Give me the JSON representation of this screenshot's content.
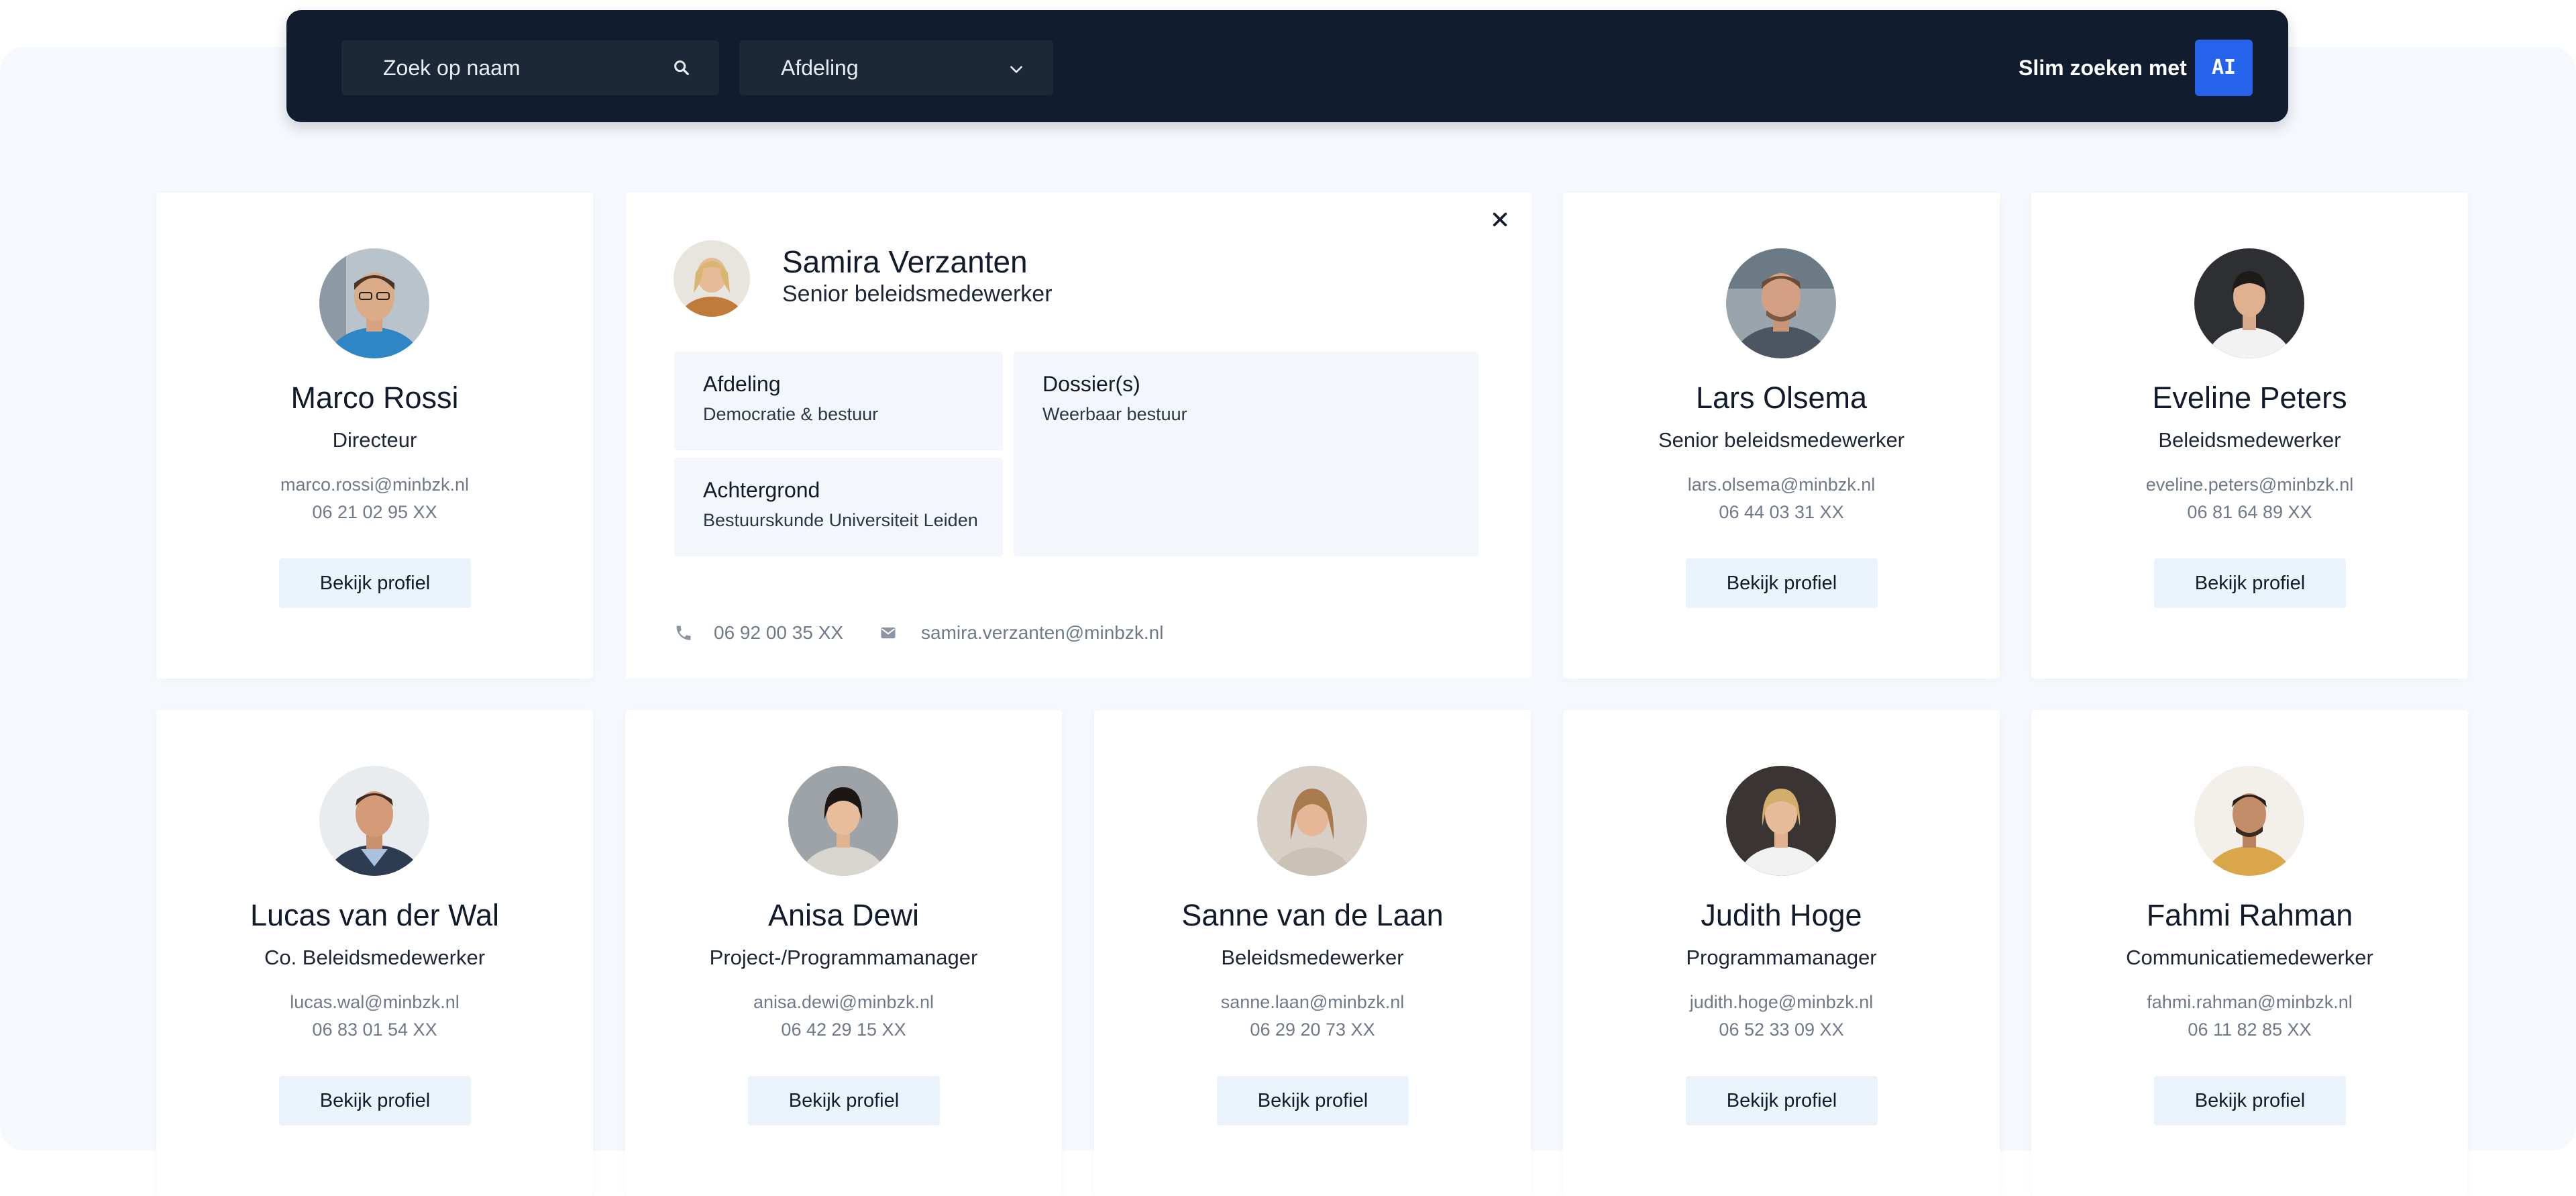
{
  "search": {
    "placeholder": "Zoek op naam"
  },
  "filter": {
    "department_label": "Afdeling"
  },
  "smart_search": {
    "label": "Slim zoeken met",
    "button": "AI"
  },
  "accent_color": "#2563eb",
  "expanded": {
    "name": "Samira Verzanten",
    "role": "Senior beleidsmedewerker",
    "afdeling_label": "Afdeling",
    "afdeling_value": "Democratie & bestuur",
    "dossier_label": "Dossier(s)",
    "dossier_value": "Weerbaar bestuur",
    "achtergrond_label": "Achtergrond",
    "achtergrond_value": "Bestuurskunde Universiteit Leiden",
    "phone": "06 92 00 35 XX",
    "email": "samira.verzanten@minbzk.nl"
  },
  "people": [
    {
      "name": "Marco Rossi",
      "role": "Directeur",
      "email": "marco.rossi@minbzk.nl",
      "phone": "06 21 02 95 XX",
      "button": "Bekijk profiel"
    },
    {
      "name": "Lars Olsema",
      "role": "Senior beleidsmedewerker",
      "email": "lars.olsema@minbzk.nl",
      "phone": "06 44 03 31 XX",
      "button": "Bekijk profiel"
    },
    {
      "name": "Eveline Peters",
      "role": "Beleidsmedewerker",
      "email": "eveline.peters@minbzk.nl",
      "phone": "06 81 64 89 XX",
      "button": "Bekijk profiel"
    },
    {
      "name": "Lucas van der Wal",
      "role": "Co. Beleidsmedewerker",
      "email": "lucas.wal@minbzk.nl",
      "phone": "06 83 01 54 XX",
      "button": "Bekijk profiel"
    },
    {
      "name": "Anisa Dewi",
      "role": "Project-/Programmamanager",
      "email": "anisa.dewi@minbzk.nl",
      "phone": "06 42 29 15 XX",
      "button": "Bekijk profiel"
    },
    {
      "name": "Sanne van de Laan",
      "role": "Beleidsmedewerker",
      "email": "sanne.laan@minbzk.nl",
      "phone": "06 29 20 73 XX",
      "button": "Bekijk profiel"
    },
    {
      "name": "Judith Hoge",
      "role": "Programmamanager",
      "email": "judith.hoge@minbzk.nl",
      "phone": "06 52 33 09 XX",
      "button": "Bekijk profiel"
    },
    {
      "name": "Fahmi Rahman",
      "role": "Communicatiemedewerker",
      "email": "fahmi.rahman@minbzk.nl",
      "phone": "06 11 82 85 XX",
      "button": "Bekijk profiel"
    }
  ]
}
